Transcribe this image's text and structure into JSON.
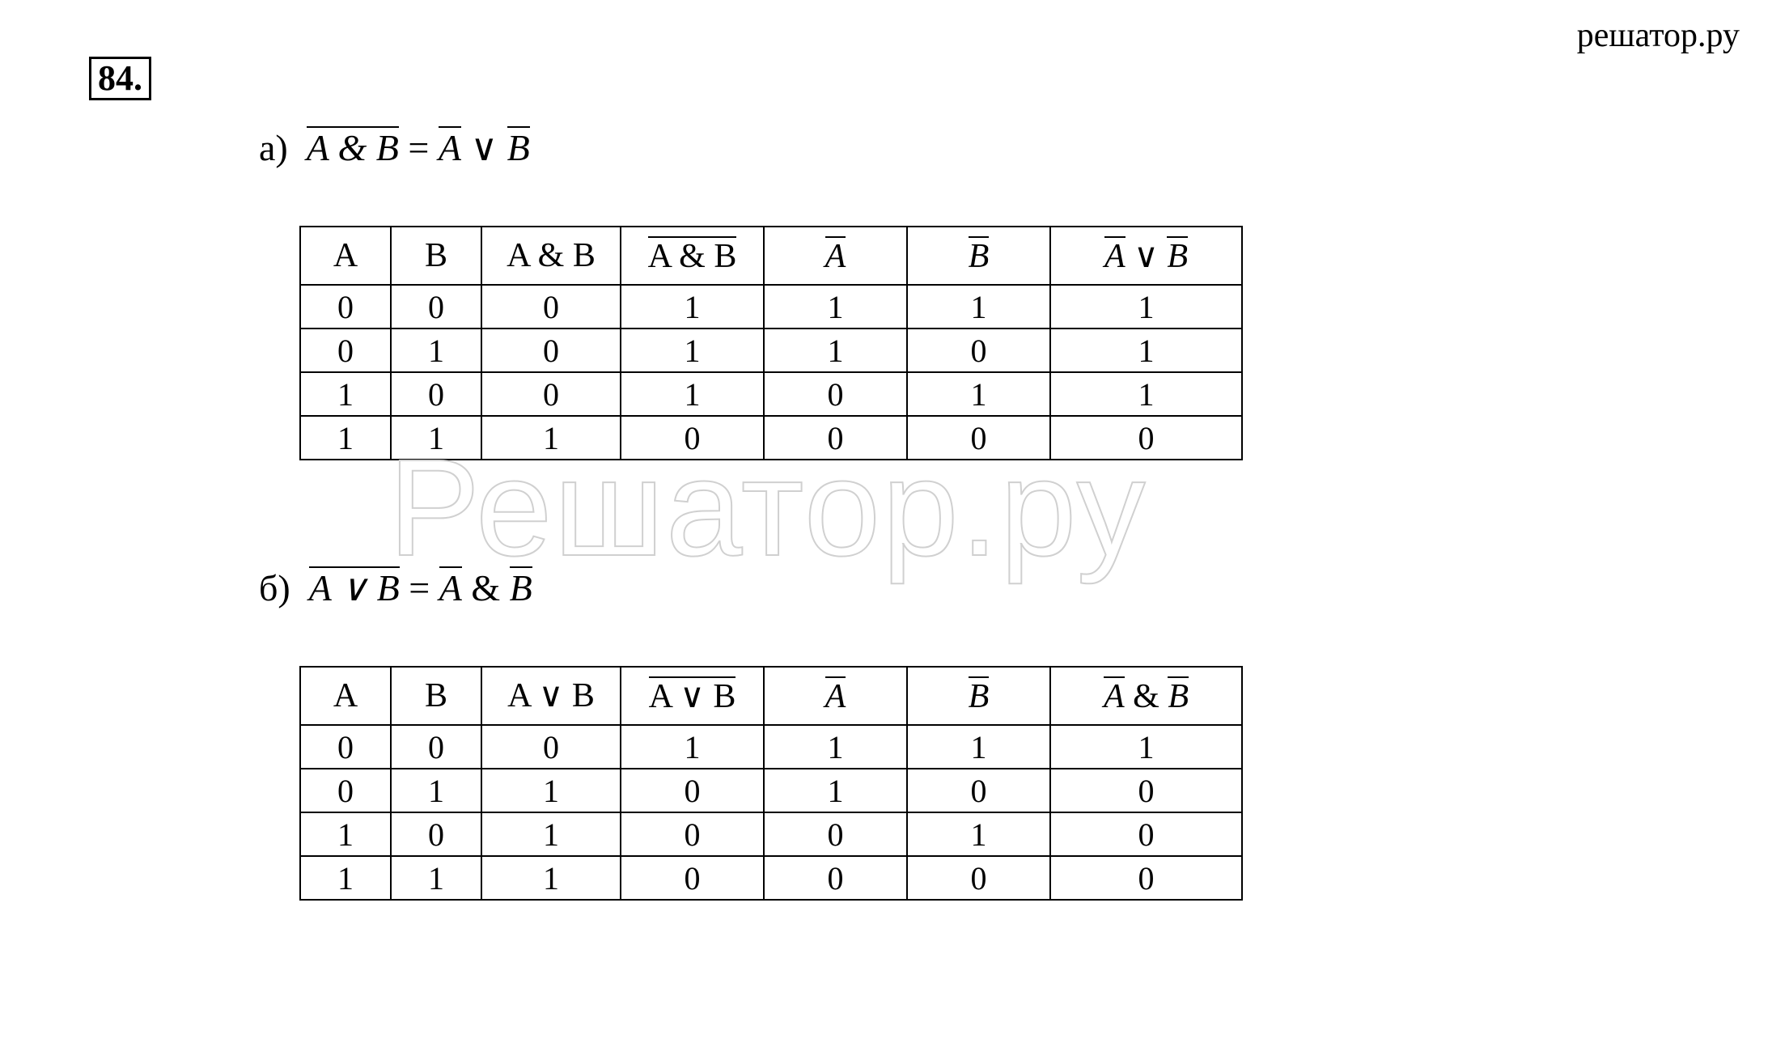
{
  "watermark_top": "решатор.ру",
  "watermark_center": "Решатор.ру",
  "problem_number": "84.",
  "section_a": {
    "label": "а)",
    "formula": {
      "lhs_overline": "A & B",
      "eq": " = ",
      "rhs_A": "A",
      "or": " ∨ ",
      "rhs_B": "B"
    },
    "headers": {
      "A": "A",
      "B": "B",
      "AandB": "A & B",
      "notAandB": "A & B",
      "notA": "A",
      "notB": "B",
      "notA_or_notB_A": "A",
      "notA_or_notB_or": " ∨ ",
      "notA_or_notB_B": "B"
    },
    "rows": [
      {
        "A": "0",
        "B": "0",
        "AandB": "0",
        "notAandB": "1",
        "notA": "1",
        "notB": "1",
        "res": "1"
      },
      {
        "A": "0",
        "B": "1",
        "AandB": "0",
        "notAandB": "1",
        "notA": "1",
        "notB": "0",
        "res": "1"
      },
      {
        "A": "1",
        "B": "0",
        "AandB": "0",
        "notAandB": "1",
        "notA": "0",
        "notB": "1",
        "res": "1"
      },
      {
        "A": "1",
        "B": "1",
        "AandB": "1",
        "notAandB": "0",
        "notA": "0",
        "notB": "0",
        "res": "0"
      }
    ]
  },
  "section_b": {
    "label": "б)",
    "formula": {
      "lhs_overline": "A ∨ B",
      "eq": " = ",
      "rhs_A": "A",
      "and": " & ",
      "rhs_B": "B"
    },
    "headers": {
      "A": "A",
      "B": "B",
      "AorB": "A ∨ B",
      "notAorB": "A ∨ B",
      "notA": "A",
      "notB": "B",
      "notA_and_notB_A": "A",
      "notA_and_notB_and": " & ",
      "notA_and_notB_B": "B"
    },
    "rows": [
      {
        "A": "0",
        "B": "0",
        "AorB": "0",
        "notAorB": "1",
        "notA": "1",
        "notB": "1",
        "res": "1"
      },
      {
        "A": "0",
        "B": "1",
        "AorB": "1",
        "notAorB": "0",
        "notA": "1",
        "notB": "0",
        "res": "0"
      },
      {
        "A": "1",
        "B": "0",
        "AorB": "1",
        "notAorB": "0",
        "notA": "0",
        "notB": "1",
        "res": "0"
      },
      {
        "A": "1",
        "B": "1",
        "AorB": "1",
        "notAorB": "0",
        "notA": "0",
        "notB": "0",
        "res": "0"
      }
    ]
  }
}
